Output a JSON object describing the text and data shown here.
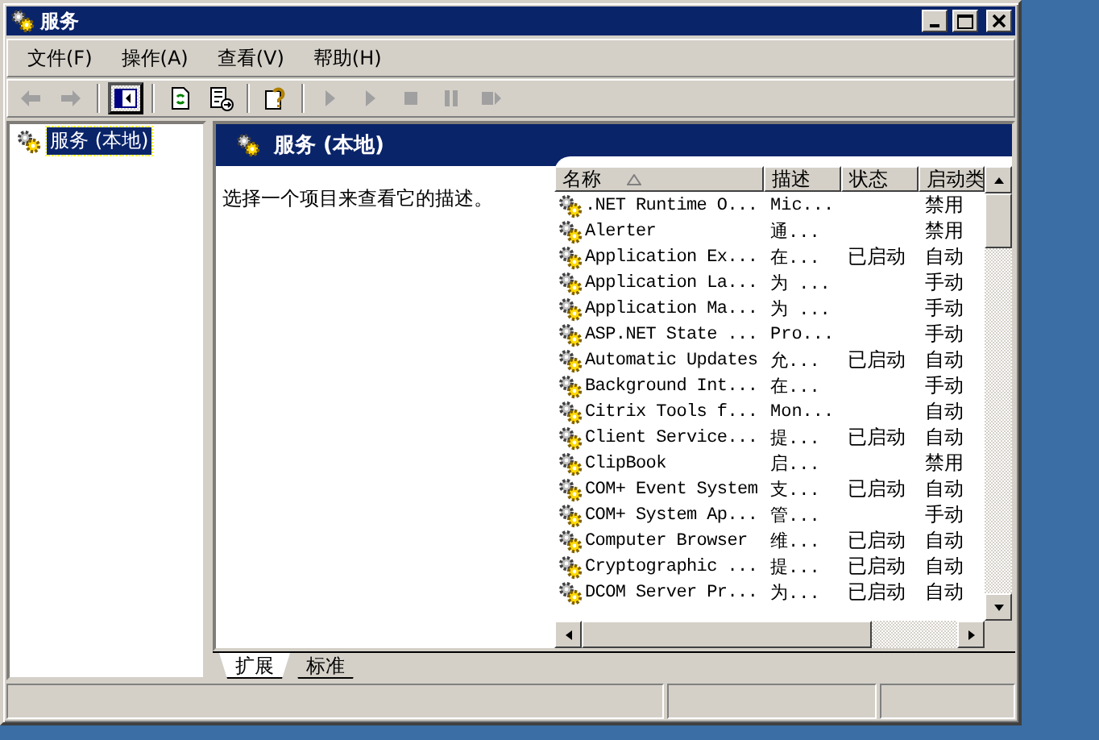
{
  "window": {
    "title": "服务"
  },
  "menu": [
    {
      "label": "文件(F)"
    },
    {
      "label": "操作(A)"
    },
    {
      "label": "查看(V)"
    },
    {
      "label": "帮助(H)"
    }
  ],
  "toolbar": [
    {
      "disabled": true,
      "pressed": false
    },
    {
      "disabled": true,
      "pressed": false
    },
    {
      "disabled": false,
      "pressed": true
    },
    {
      "disabled": false,
      "pressed": false
    },
    {
      "disabled": false,
      "pressed": false
    },
    {
      "disabled": false,
      "pressed": false
    },
    {
      "disabled": true,
      "pressed": false
    },
    {
      "disabled": true,
      "pressed": false
    },
    {
      "disabled": true,
      "pressed": false
    },
    {
      "disabled": true,
      "pressed": false
    },
    {
      "disabled": true,
      "pressed": false
    }
  ],
  "tree": [
    {
      "label": "服务 (本地)",
      "selected": true
    }
  ],
  "pane": {
    "title": "服务 (本地)",
    "description": "选择一个项目来查看它的描述。"
  },
  "columns": [
    {
      "label": "名称",
      "sorted": true
    },
    {
      "label": "描述",
      "sorted": false
    },
    {
      "label": "状态",
      "sorted": false
    },
    {
      "label": "启动类",
      "sorted": false
    }
  ],
  "rows": [
    {
      "name": ".NET Runtime O...",
      "description": "Mic...",
      "status": "",
      "startup": "禁用"
    },
    {
      "name": "Alerter",
      "description": "通...",
      "status": "",
      "startup": "禁用"
    },
    {
      "name": "Application Ex...",
      "description": "在...",
      "status": "已启动",
      "startup": "自动"
    },
    {
      "name": "Application La...",
      "description": "为 ...",
      "status": "",
      "startup": "手动"
    },
    {
      "name": "Application Ma...",
      "description": "为 ...",
      "status": "",
      "startup": "手动"
    },
    {
      "name": "ASP.NET State ...",
      "description": "Pro...",
      "status": "",
      "startup": "手动"
    },
    {
      "name": "Automatic Updates",
      "description": "允...",
      "status": "已启动",
      "startup": "自动"
    },
    {
      "name": "Background Int...",
      "description": "在...",
      "status": "",
      "startup": "手动"
    },
    {
      "name": "Citrix Tools f...",
      "description": "Mon...",
      "status": "",
      "startup": "自动"
    },
    {
      "name": "Client Service...",
      "description": "提...",
      "status": "已启动",
      "startup": "自动"
    },
    {
      "name": "ClipBook",
      "description": "启...",
      "status": "",
      "startup": "禁用"
    },
    {
      "name": "COM+ Event System",
      "description": "支...",
      "status": "已启动",
      "startup": "自动"
    },
    {
      "name": "COM+ System Ap...",
      "description": "管...",
      "status": "",
      "startup": "手动"
    },
    {
      "name": "Computer Browser",
      "description": "维...",
      "status": "已启动",
      "startup": "自动"
    },
    {
      "name": "Cryptographic ...",
      "description": "提...",
      "status": "已启动",
      "startup": "自动"
    },
    {
      "name": "DCOM Server Pr...",
      "description": "为...",
      "status": "已启动",
      "startup": "自动"
    }
  ],
  "tabs": [
    {
      "label": "扩展",
      "selected": true
    },
    {
      "label": "标准",
      "selected": false
    }
  ]
}
